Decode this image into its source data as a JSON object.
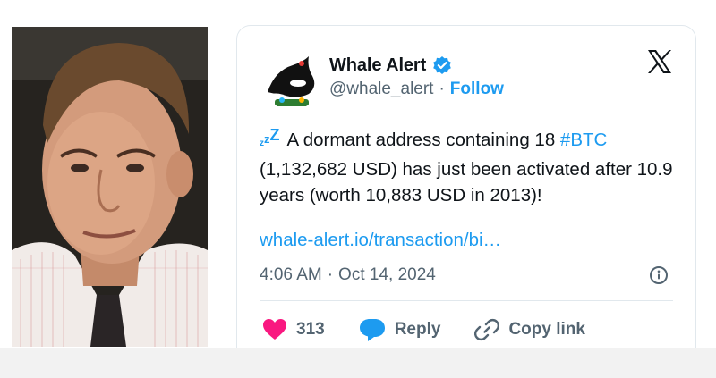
{
  "tweet": {
    "display_name": "Whale Alert",
    "handle": "@whale_alert",
    "separator": "·",
    "follow_label": "Follow",
    "text_part1": "A dormant address containing 18 ",
    "hashtag": "#BTC",
    "text_part2": " (1,132,682 USD) has just been activated after 10.9 years (worth 10,883 USD in 2013)!",
    "link": "whale-alert.io/transaction/bi…",
    "time": "4:06 AM",
    "date": "Oct 14, 2024",
    "like_count": "313",
    "reply_label": "Reply",
    "copy_link_label": "Copy link"
  },
  "icons": {
    "verified": "verified-badge-icon",
    "x_logo": "x-logo-icon",
    "info": "info-icon",
    "like": "heart-icon",
    "reply": "speech-bubble-icon",
    "copy": "link-icon",
    "zzz": "zzz-emoji-icon"
  },
  "colors": {
    "accent": "#1d9bf0",
    "like": "#f91880",
    "text": "#0f1419",
    "muted": "#536471"
  }
}
